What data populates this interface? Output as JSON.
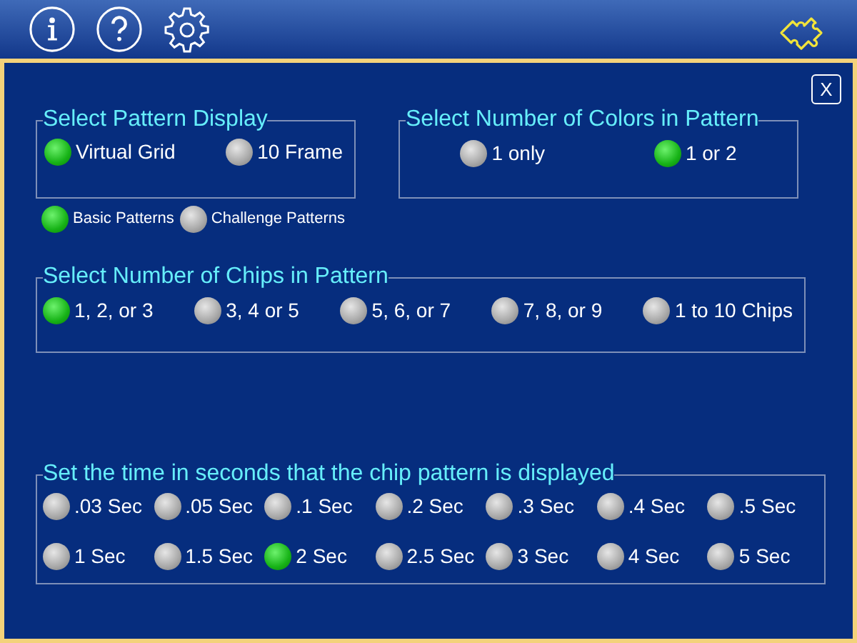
{
  "close_button": {
    "label": "X"
  },
  "pattern_display": {
    "title": "Select Pattern Display",
    "options": [
      {
        "label": "Virtual Grid",
        "selected": true
      },
      {
        "label": "10 Frame",
        "selected": false
      }
    ]
  },
  "pattern_type": {
    "options": [
      {
        "label": "Basic Patterns",
        "selected": true
      },
      {
        "label": "Challenge Patterns",
        "selected": false
      }
    ]
  },
  "colors": {
    "title": "Select Number of Colors in Pattern",
    "options": [
      {
        "label": "1 only",
        "selected": false
      },
      {
        "label": "1 or 2",
        "selected": true
      }
    ]
  },
  "chips": {
    "title": "Select Number of Chips in Pattern",
    "options": [
      {
        "label": "1, 2, or 3",
        "selected": true
      },
      {
        "label": "3, 4 or 5",
        "selected": false
      },
      {
        "label": "5, 6, or 7",
        "selected": false
      },
      {
        "label": "7, 8, or 9",
        "selected": false
      },
      {
        "label": "1 to 10 Chips",
        "selected": false
      }
    ]
  },
  "display_time": {
    "title": "Set the time in seconds that the chip pattern is displayed",
    "rows": [
      [
        {
          "label": ".03 Sec",
          "selected": false
        },
        {
          "label": ".05 Sec",
          "selected": false
        },
        {
          "label": ".1 Sec",
          "selected": false
        },
        {
          "label": ".2 Sec",
          "selected": false
        },
        {
          "label": ".3 Sec",
          "selected": false
        },
        {
          "label": ".4 Sec",
          "selected": false
        },
        {
          "label": ".5 Sec",
          "selected": false
        }
      ],
      [
        {
          "label": "1 Sec",
          "selected": false
        },
        {
          "label": "1.5 Sec",
          "selected": false
        },
        {
          "label": "2 Sec",
          "selected": true
        },
        {
          "label": "2.5 Sec",
          "selected": false
        },
        {
          "label": "3 Sec",
          "selected": false
        },
        {
          "label": "4 Sec",
          "selected": false
        },
        {
          "label": "5 Sec",
          "selected": false
        }
      ]
    ]
  }
}
